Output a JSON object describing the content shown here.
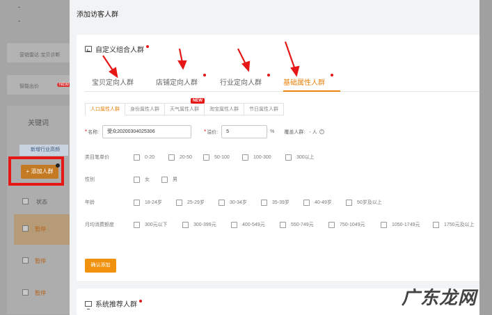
{
  "background": {
    "dash1": "-",
    "dash2": "-",
    "item1": "营销雷达·宝贝诊断",
    "item2": "智能出价",
    "item2_badge": "NEW",
    "keyword_label": "关键词",
    "info_text": "新增行业高频",
    "add_button": "+ 添加人群",
    "col_status": "状态",
    "row_status": [
      "暂停",
      "暂停",
      "暂停"
    ]
  },
  "modal": {
    "title": "添加访客人群",
    "custom_section": {
      "title": "自定义组合人群",
      "tabs": [
        {
          "label": "宝贝定向人群",
          "active": false
        },
        {
          "label": "店铺定向人群",
          "active": false
        },
        {
          "label": "行业定向人群",
          "active": false
        },
        {
          "label": "基础属性人群",
          "active": true
        }
      ],
      "subtabs": [
        {
          "label": "人口属性人群",
          "active": true
        },
        {
          "label": "身份属性人群",
          "active": false
        },
        {
          "label": "天气属性人群",
          "active": false,
          "tag": "NEW"
        },
        {
          "label": "淘宝属性人群",
          "active": false
        },
        {
          "label": "节日属性人群",
          "active": false
        }
      ],
      "form": {
        "name_label": "名称:",
        "name_value": "受众20200304025306",
        "premium_label": "溢价:",
        "premium_value": "5",
        "premium_unit": "%",
        "coverage_label": "覆盖人群:",
        "coverage_value": "- 人",
        "help_glyph": "?"
      },
      "options": [
        {
          "label": "类目笔单价",
          "items": [
            "0-20",
            "20-50",
            "50-100",
            "100-300",
            "300以上"
          ]
        },
        {
          "label": "性别",
          "items": [
            "女",
            "男"
          ]
        },
        {
          "label": "年龄",
          "items": [
            "18-24岁",
            "25-29岁",
            "30-34岁",
            "35-39岁",
            "40-49岁",
            "50岁及以上"
          ]
        },
        {
          "label": "月均消费额度",
          "items": [
            "300元以下",
            "300-399元",
            "400-549元",
            "550-749元",
            "750-1049元",
            "1050-1749元",
            "1750元及以上"
          ]
        }
      ],
      "confirm_button": "确认添加"
    },
    "recommend_section": {
      "title": "系统推荐人群"
    }
  },
  "watermark": "广东龙网"
}
